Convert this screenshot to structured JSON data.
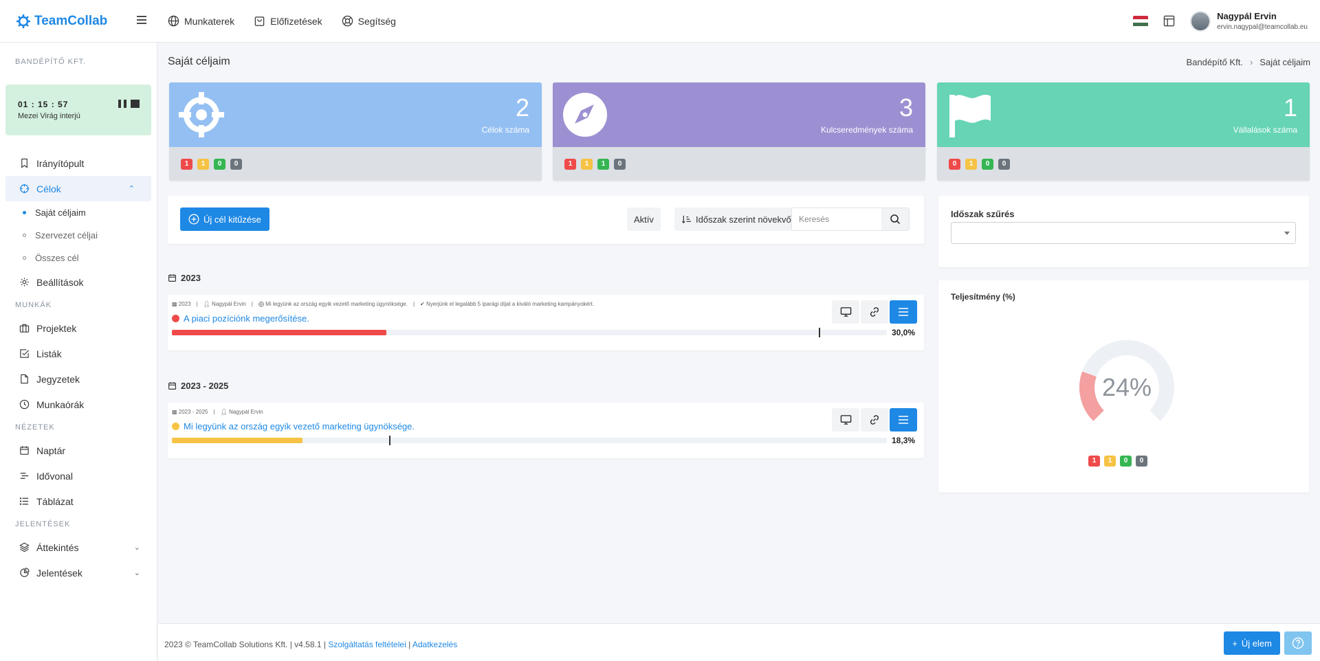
{
  "app": {
    "name": "TeamCollab"
  },
  "topnav": [
    {
      "label": "Munkaterek",
      "icon": "globe-icon"
    },
    {
      "label": "Előfizetések",
      "icon": "bag-icon"
    },
    {
      "label": "Segítség",
      "icon": "lifebuoy-icon"
    }
  ],
  "user": {
    "name": "Nagypál Ervin",
    "email": "ervin.nagypal@teamcollab.eu"
  },
  "sidebar": {
    "company": "BANDÉPÍTŐ KFT.",
    "timer": {
      "time": "01 : 15 : 57",
      "title": "Mezei Virág interjú"
    },
    "dashboard": "Irányítópult",
    "goals": "Célok",
    "goals_sub": [
      "Saját céljaim",
      "Szervezet céljai",
      "Összes cél"
    ],
    "settings": "Beállítások",
    "section_work": "MUNKÁK",
    "projects": "Projektek",
    "lists": "Listák",
    "notes": "Jegyzetek",
    "hours": "Munkaórák",
    "section_views": "NÉZETEK",
    "calendar": "Naptár",
    "timeline": "Idővonal",
    "table": "Táblázat",
    "section_reports": "JELENTÉSEK",
    "overview": "Áttekintés",
    "reports": "Jelentések"
  },
  "page": {
    "title": "Saját céljaim",
    "breadcrumb": [
      "Bandépítő Kft.",
      "Saját céljaim"
    ]
  },
  "stats": [
    {
      "number": "2",
      "label": "Célok száma",
      "color": "#94bff2",
      "badges": [
        "1",
        "1",
        "0",
        "0"
      ]
    },
    {
      "number": "3",
      "label": "Kulcseredmények száma",
      "color": "#9d90d2",
      "badges": [
        "1",
        "1",
        "1",
        "0"
      ]
    },
    {
      "number": "1",
      "label": "Vállalások száma",
      "color": "#66d4b5",
      "badges": [
        "0",
        "1",
        "0",
        "0"
      ]
    }
  ],
  "badge_colors": [
    "#ef4a4a",
    "#f6c344",
    "#35b653",
    "#6c757d"
  ],
  "toolbar": {
    "new_goal": "Új cél kitűzése",
    "active": "Aktív",
    "sort": "Időszak szerint növekvő",
    "search_placeholder": "Keresés"
  },
  "groups": [
    {
      "year": "2023",
      "goal": {
        "meta_period": "2023",
        "meta_owner": "Nagypál Ervin",
        "meta_parent": "Mi legyünk az ország egyik vezető marketing ügynöksége.",
        "meta_kr": "Nyerjünk el legalább 5 iparági díjat a kiváló marketing kampányokért.",
        "title": "A piaci pozíciónk megerősítése.",
        "status_color": "#ef4a4a",
        "progress": 30.0,
        "expected": 90.5,
        "percent": "30,0%"
      }
    },
    {
      "year": "2023 - 2025",
      "goal": {
        "meta_period": "2023 - 2025",
        "meta_owner": "Nagypál Ervin",
        "title": "Mi legyünk az ország egyik vezető marketing ügynöksége.",
        "status_color": "#f6c344",
        "progress": 18.3,
        "expected": 30.4,
        "percent": "18,3%"
      }
    }
  ],
  "filter": {
    "label": "Időszak szűrés",
    "value": ""
  },
  "performance": {
    "title": "Teljesítmény (%)",
    "value": 24,
    "label": "24%",
    "badges": [
      "1",
      "1",
      "0",
      "0"
    ],
    "fill_color": "#f4a0a0",
    "track_color": "#edf0f4"
  },
  "footer": {
    "copyright": "2023 © TeamCollab Solutions Kft. | v4.58.1 | ",
    "terms": "Szolgáltatás feltételei",
    "sep": " | ",
    "privacy": "Adatkezelés",
    "new_item": "Új elem"
  }
}
